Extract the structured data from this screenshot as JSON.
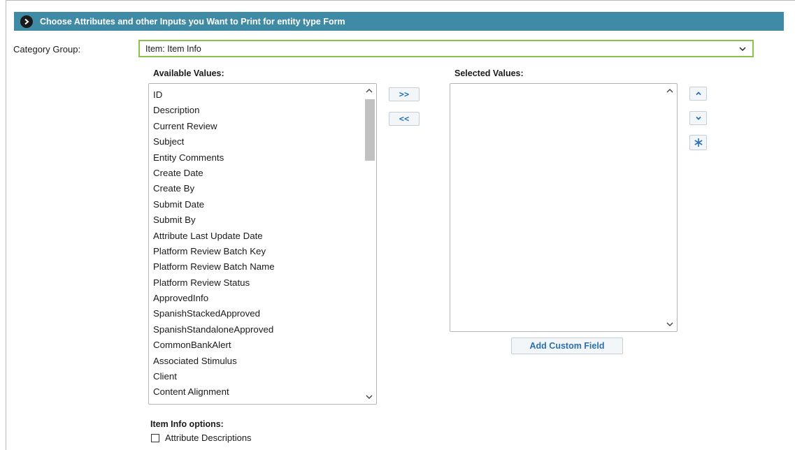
{
  "header": {
    "title": "Choose Attributes and other Inputs you Want to Print for entity type Form",
    "icon": "chevron-right-circle-icon"
  },
  "category_group": {
    "label": "Category Group:",
    "selected": "Item: Item Info"
  },
  "available": {
    "label": "Available Values:",
    "items": [
      "ID",
      "Description",
      "Current Review",
      "Subject",
      "Entity Comments",
      "Create Date",
      "Create By",
      "Submit Date",
      "Submit By",
      "Attribute Last Update Date",
      "Platform Review Batch Key",
      "Platform Review Batch Name",
      "Platform Review Status",
      "ApprovedInfo",
      "SpanishStackedApproved",
      "SpanishStandaloneApproved",
      "CommonBankAlert",
      "Associated Stimulus",
      "Client",
      "Content Alignment"
    ]
  },
  "transfer": {
    "add_label": ">>",
    "remove_label": "<<"
  },
  "selected": {
    "label": "Selected Values:",
    "items": []
  },
  "order_buttons": {
    "up": "^",
    "down": "v",
    "clear_icon": "asterisk-icon"
  },
  "add_custom_field": "Add Custom Field",
  "options": {
    "label": "Item Info options:",
    "checkbox_label": "Attribute Descriptions",
    "checked": false
  },
  "colors": {
    "header_bg": "#3f8aa5",
    "select_border": "#8bc34a",
    "button_text": "#2a6fb3"
  }
}
